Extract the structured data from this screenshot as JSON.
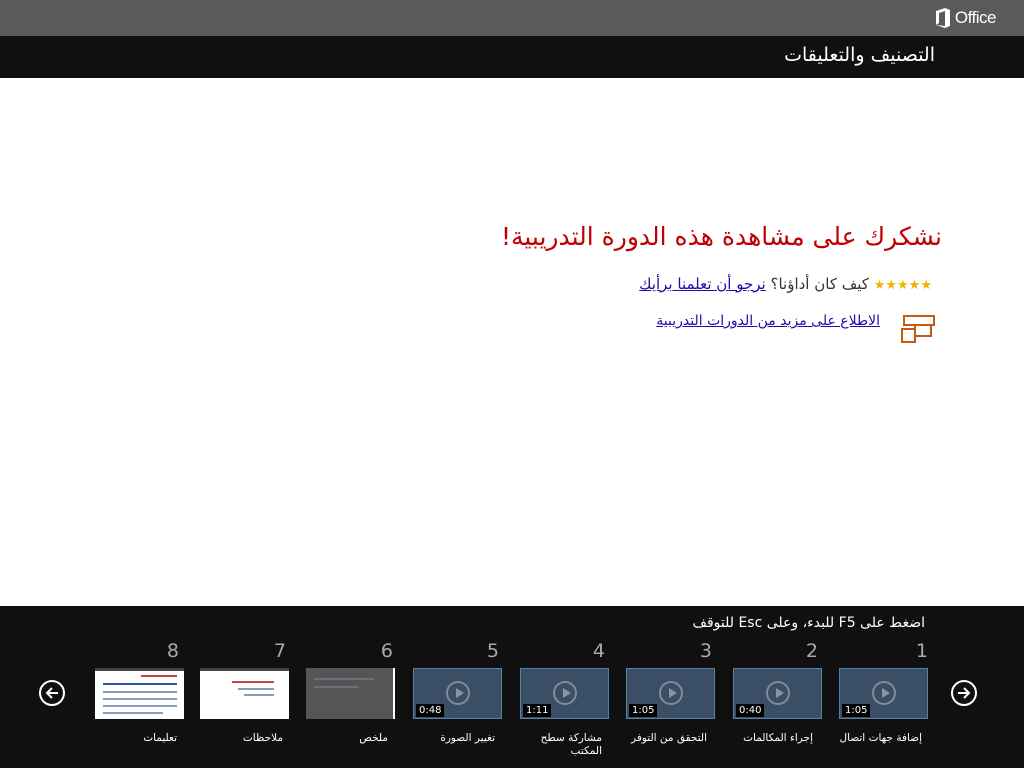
{
  "header": {
    "app_name": "Office",
    "page_title": "التصنيف والتعليقات"
  },
  "main": {
    "heading": "نشكرك على مشاهدة هذه الدورة التدريبية!",
    "rating": {
      "stars_label": "★★★★★",
      "question": "كيف كان أداؤنا؟",
      "link_text": "نرجو أن تعلمنا برأيك"
    },
    "more_courses_link": "الاطلاع على مزيد من الدورات التدريبية"
  },
  "footer": {
    "instructions": "اضغط على F5 للبدء، وعلى Esc للتوقف",
    "thumbnails": [
      {
        "number": "1",
        "label": "إضافة جهات اتصال",
        "duration": "1:05",
        "kind": "video"
      },
      {
        "number": "2",
        "label": "إجراء المكالمات",
        "duration": "0:40",
        "kind": "video"
      },
      {
        "number": "3",
        "label": "التحقق من التوفر",
        "duration": "1:05",
        "kind": "video"
      },
      {
        "number": "4",
        "label": "مشاركة سطح المكتب",
        "duration": "1:11",
        "kind": "video"
      },
      {
        "number": "5",
        "label": "تغيير الصورة",
        "duration": "0:48",
        "kind": "video"
      },
      {
        "number": "6",
        "label": "ملخص",
        "duration": "",
        "kind": "dim"
      },
      {
        "number": "7",
        "label": "ملاحظات",
        "duration": "",
        "kind": "doc"
      },
      {
        "number": "8",
        "label": "تعليمات",
        "duration": "",
        "kind": "doc"
      }
    ]
  },
  "colors": {
    "heading": "#c00000",
    "link": "#1a0dab",
    "stars": "#f2b200"
  }
}
